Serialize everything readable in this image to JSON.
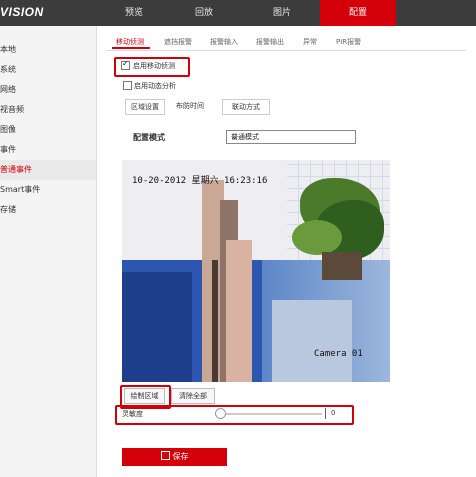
{
  "header": {
    "brand": "VISION",
    "nav": [
      "预览",
      "回放",
      "图片",
      "配置"
    ]
  },
  "sidebar": {
    "items": [
      "本地",
      "系统",
      "网络",
      "视音频",
      "图像",
      "事件",
      "普通事件",
      "Smart事件",
      "存储"
    ]
  },
  "tabs": [
    "移动侦测",
    "遮挡报警",
    "报警输入",
    "报警输出",
    "异常",
    "PIR报警"
  ],
  "enable_motion": {
    "label": "启用移动侦测",
    "checked": true
  },
  "dynamic_analysis": {
    "label": "启用动态分析",
    "checked": false
  },
  "subtabs": [
    "区域设置",
    "布防时间",
    "联动方式"
  ],
  "config_mode": {
    "label": "配置模式",
    "value": "普通模式"
  },
  "video": {
    "timestamp": "10-20-2012 星期六 16:23:16",
    "camera_name": "Camera 01"
  },
  "buttons": {
    "draw_area": "绘制区域",
    "clear_all": "清除全部",
    "save": "保存"
  },
  "sensitivity": {
    "label": "灵敏度",
    "value": "0",
    "level": 0
  },
  "colors": {
    "accent": "#d3000a",
    "topbar": "#3c3c3c"
  },
  "icons": {
    "save": "save-icon",
    "dropdown": "chevron-down-icon"
  }
}
